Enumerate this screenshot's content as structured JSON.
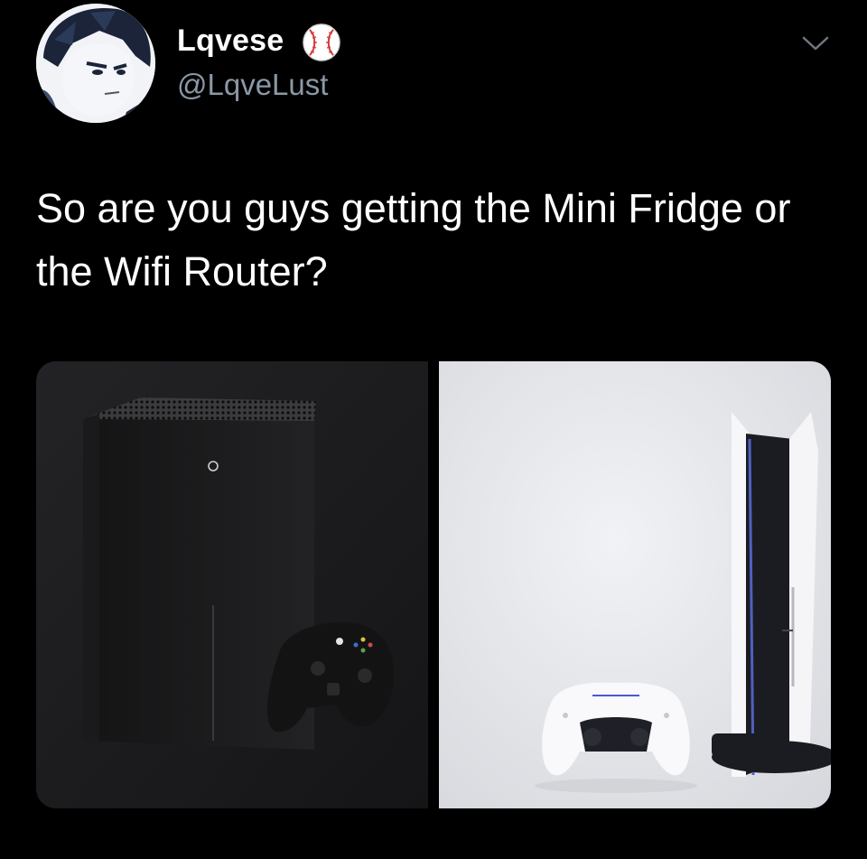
{
  "tweet": {
    "author": {
      "display_name": "Lqvese",
      "handle": "@LqveLust",
      "badge_icon": "baseball-icon",
      "avatar_icon": "anime-avatar"
    },
    "text": "So are you guys getting the Mini Fridge or the Wifi Router?",
    "menu_icon": "chevron-down-icon",
    "media": [
      {
        "icon": "xbox-series-x-console",
        "background": "#1e1e20"
      },
      {
        "icon": "playstation-5-console",
        "background": "#e6e7ea"
      }
    ]
  },
  "colors": {
    "background": "#000000",
    "text_primary": "#ffffff",
    "text_secondary": "#8b98a5"
  }
}
